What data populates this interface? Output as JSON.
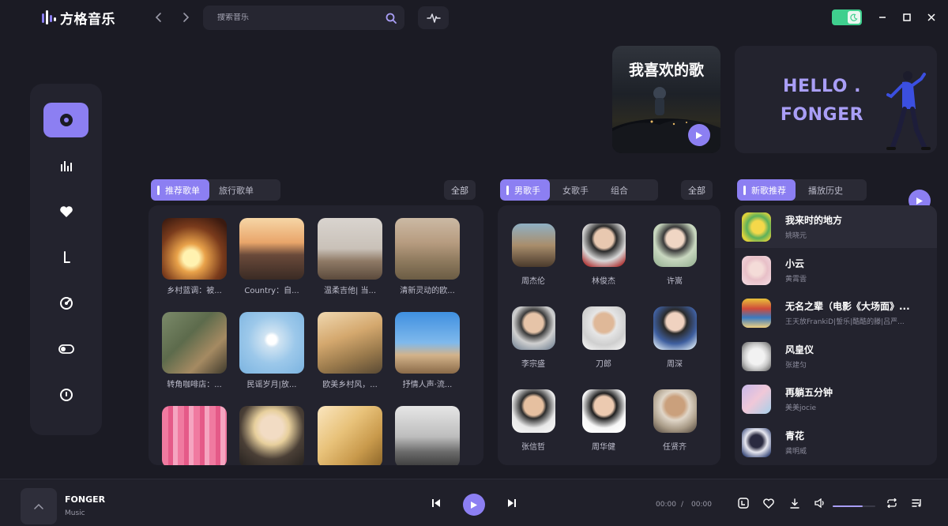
{
  "app": {
    "title": "方格音乐"
  },
  "search": {
    "placeholder": "搜索音乐"
  },
  "banners": {
    "favorites_title": "我喜欢的歌",
    "hello_line1": "HELLO .",
    "hello_line2": "FONGER"
  },
  "playlists": {
    "tabs": [
      "推荐歌单",
      "旅行歌单"
    ],
    "all_label": "全部",
    "items": [
      {
        "name": "乡村蓝调：被..."
      },
      {
        "name": "Country：自..."
      },
      {
        "name": "温柔吉他| 当..."
      },
      {
        "name": "清新灵动的欧..."
      },
      {
        "name": "转角咖啡店：..."
      },
      {
        "name": "民谣岁月|放..."
      },
      {
        "name": "欧美乡村风，..."
      },
      {
        "name": "抒情人声·流..."
      },
      {
        "name": ""
      },
      {
        "name": ""
      },
      {
        "name": ""
      },
      {
        "name": ""
      }
    ]
  },
  "singers": {
    "tabs": [
      "男歌手",
      "女歌手",
      "组合"
    ],
    "all_label": "全部",
    "items": [
      {
        "name": "周杰伦"
      },
      {
        "name": "林俊杰"
      },
      {
        "name": "许嵩"
      },
      {
        "name": "李宗盛"
      },
      {
        "name": "刀郎"
      },
      {
        "name": "周深"
      },
      {
        "name": "张信哲"
      },
      {
        "name": "周华健"
      },
      {
        "name": "任贤齐"
      }
    ]
  },
  "songs": {
    "tabs": [
      "新歌推荐",
      "播放历史"
    ],
    "items": [
      {
        "title": "我来时的地方",
        "artist": "姚晓元"
      },
      {
        "title": "小云",
        "artist": "黄霄雲"
      },
      {
        "title": "无名之辈（电影《大场面》...",
        "artist": "王天放FrankiD|誓乐|酷酷的滕|吕严..."
      },
      {
        "title": "风皇仪",
        "artist": "张建匀"
      },
      {
        "title": "再躺五分钟",
        "artist": "美美jocie"
      },
      {
        "title": "青花",
        "artist": "龚明威"
      }
    ]
  },
  "player": {
    "title": "FONGER",
    "subtitle": "Music",
    "current_time": "00:00",
    "separator": "/",
    "total_time": "00:00",
    "volume": 0.7
  },
  "colors": {
    "accent": "#8c7ff2",
    "background": "#1b1b24",
    "panel": "#23232e",
    "toggle": "#3fcf8e"
  }
}
